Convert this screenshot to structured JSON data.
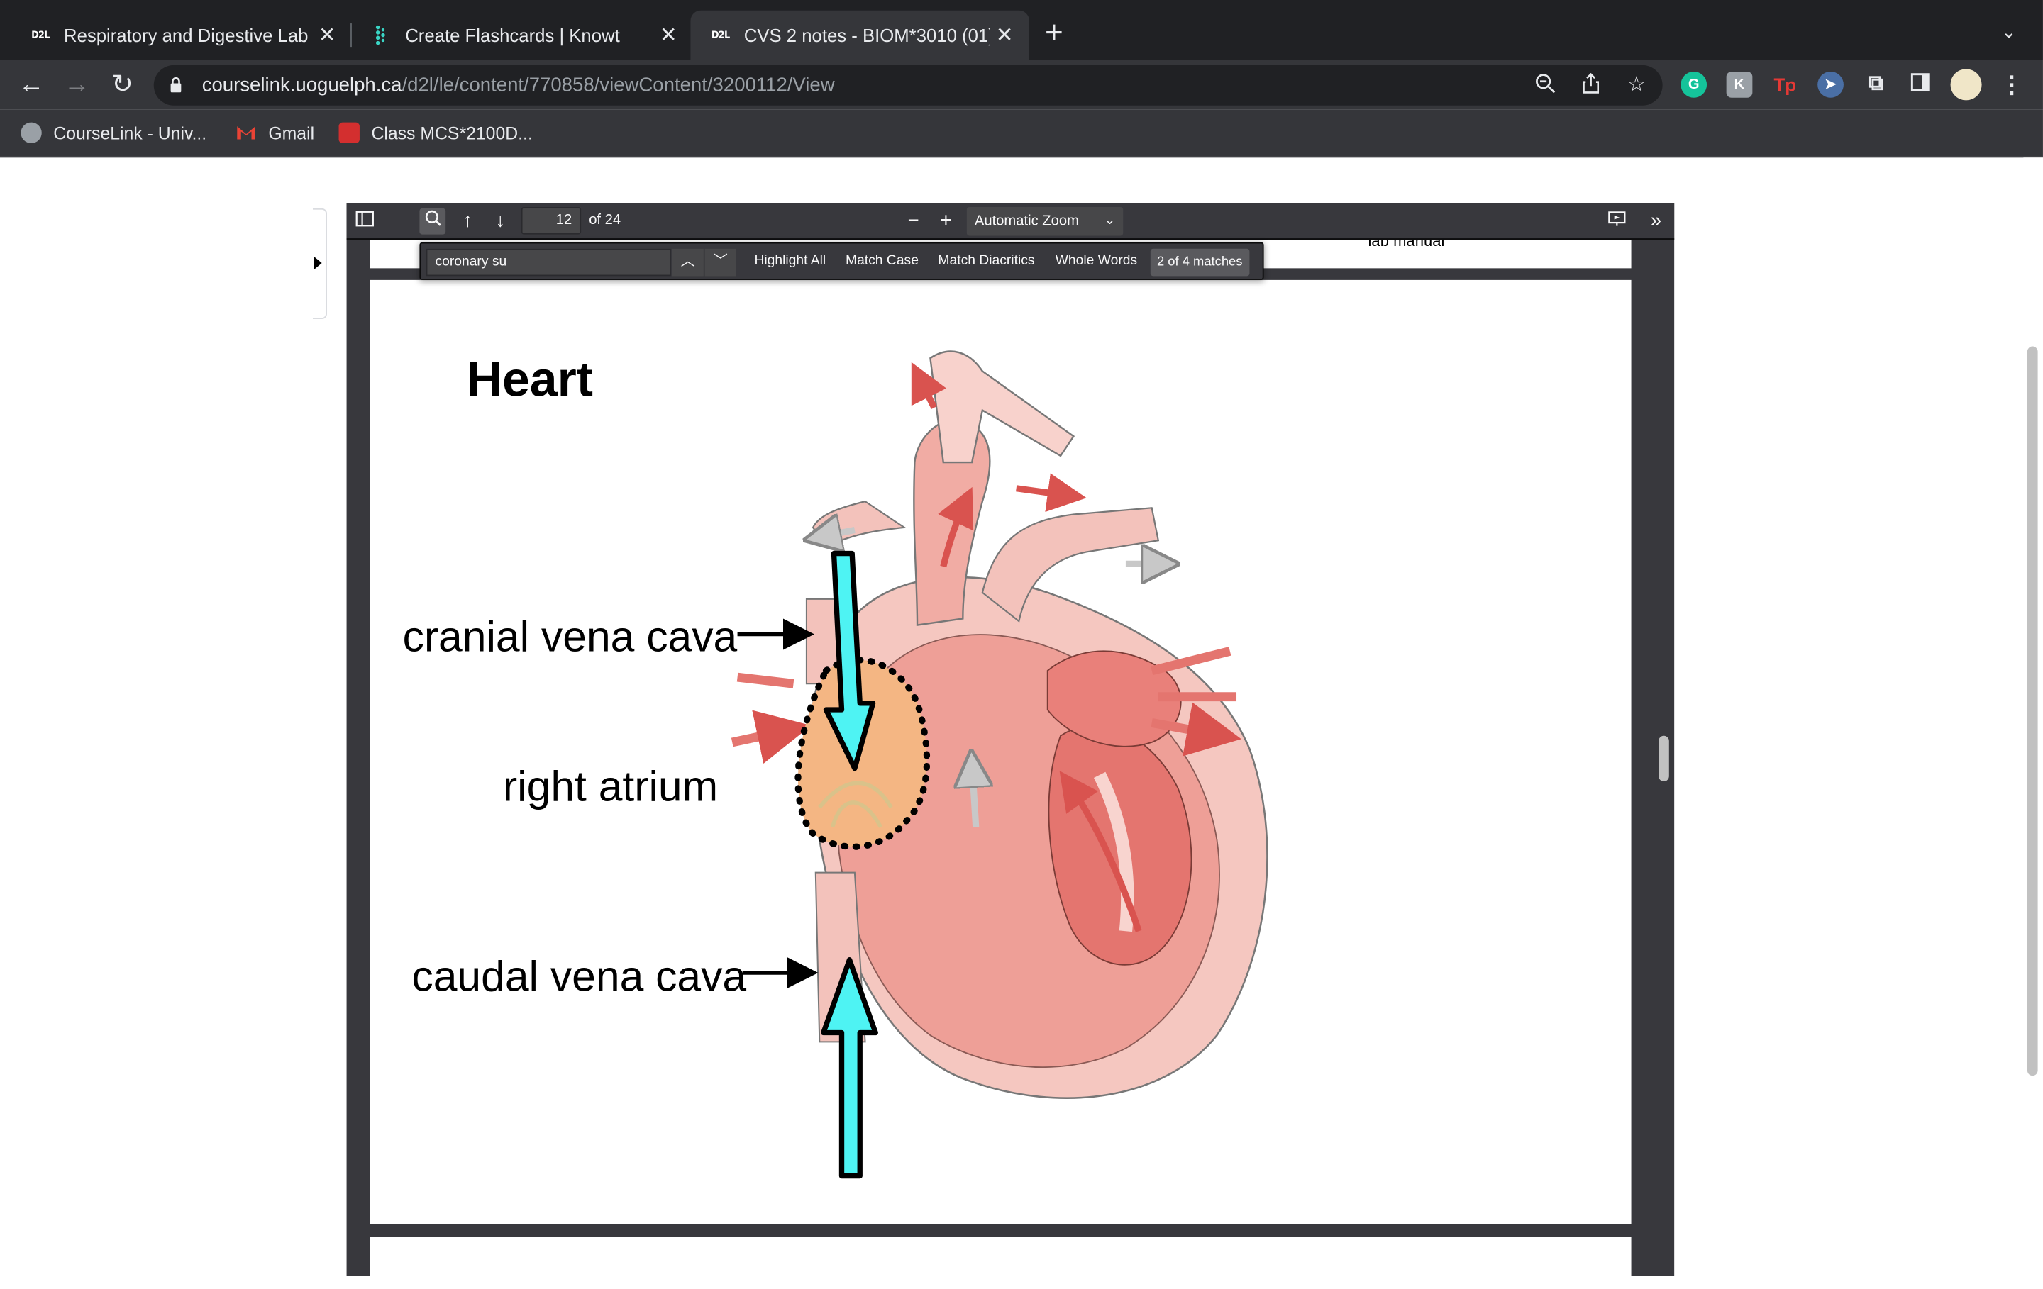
{
  "browser": {
    "tabs": [
      {
        "favicon": "D2L",
        "title": "Respiratory and Digestive Lab"
      },
      {
        "favicon": "knowt-icon",
        "title": "Create Flashcards | Knowt"
      },
      {
        "favicon": "D2L",
        "title": "CVS 2 notes - BIOM*3010 (01)"
      }
    ],
    "url_host": "courselink.uoguelph.ca",
    "url_path": "/d2l/le/content/770858/viewContent/3200112/View",
    "bookmarks": [
      "CourseLink - Univ...",
      "Gmail",
      "Class MCS*2100D..."
    ]
  },
  "pdf_viewer": {
    "page_number": "12",
    "page_of": "of 24",
    "zoom": "Automatic Zoom",
    "find": {
      "query": "coronary su",
      "options": [
        "Highlight All",
        "Match Case",
        "Match Diacritics",
        "Whole Words"
      ],
      "result": "2 of 4 matches"
    },
    "prev_page_text": "lab manual"
  },
  "slide": {
    "title": "Heart",
    "labels": {
      "cranial": "cranial vena cava",
      "atrium": "right atrium",
      "caudal": "caudal vena cava"
    }
  },
  "colors": {
    "chrome_dark": "#202124",
    "toolbar": "#35363a",
    "pdf_toolbar": "#38383d",
    "flow_arrow": "#4ef3f3",
    "heart_red": "#e4756f",
    "atrium_fill": "#f4b683"
  }
}
